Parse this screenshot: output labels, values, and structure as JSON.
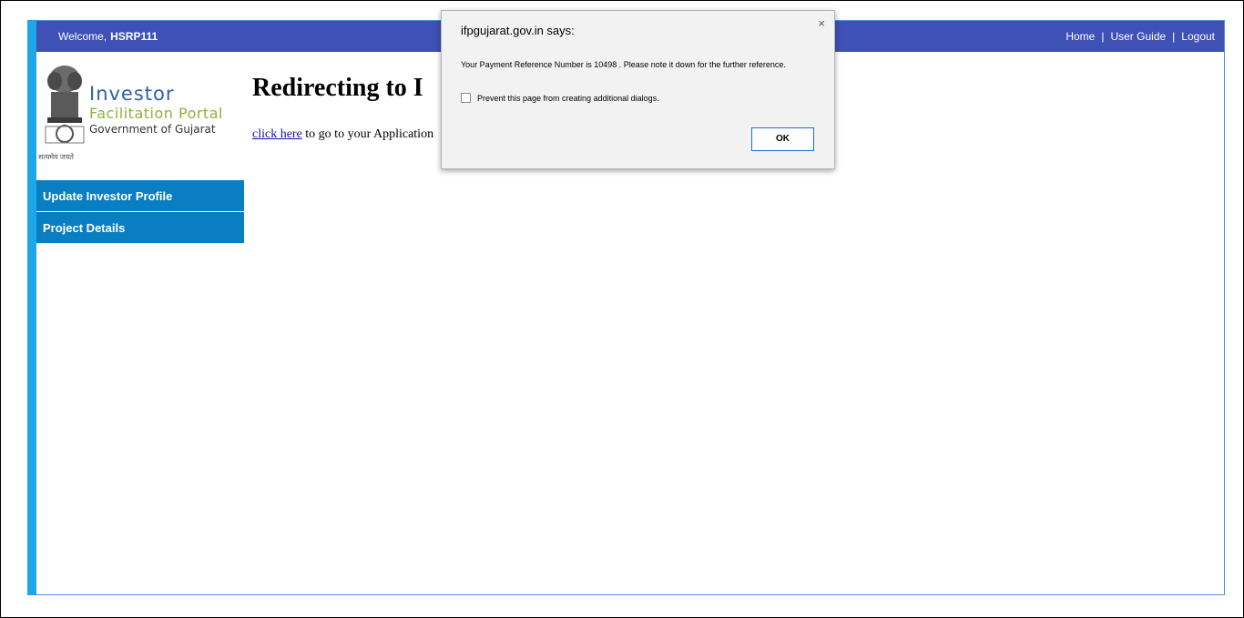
{
  "header": {
    "welcome_label": "Welcome,",
    "username": "HSRP111",
    "links": {
      "home": "Home",
      "user_guide": "User Guide",
      "logout": "Logout",
      "separator": "|"
    }
  },
  "logo": {
    "line1": "Investor",
    "line2": "Facilitation Portal",
    "line3": "Government of Gujarat",
    "motto": "सत्यमेव जयते"
  },
  "sidebar": {
    "items": [
      {
        "label": "Update Investor Profile"
      },
      {
        "label": "Project Details"
      }
    ]
  },
  "main": {
    "heading": "Redirecting to I",
    "link_text": "click here",
    "line_rest": " to go to your Application"
  },
  "dialog": {
    "title": "ifpgujarat.gov.in says:",
    "close": "×",
    "message": "Your Payment Reference Number is 10498 . Please note it down for the further reference.",
    "checkbox_label": "Prevent this page from creating additional dialogs.",
    "ok_label": "OK"
  },
  "colors": {
    "top_bar": "#3f51b5",
    "nav": "#0a7ec2",
    "frame_accent": "#1ea7e8"
  }
}
